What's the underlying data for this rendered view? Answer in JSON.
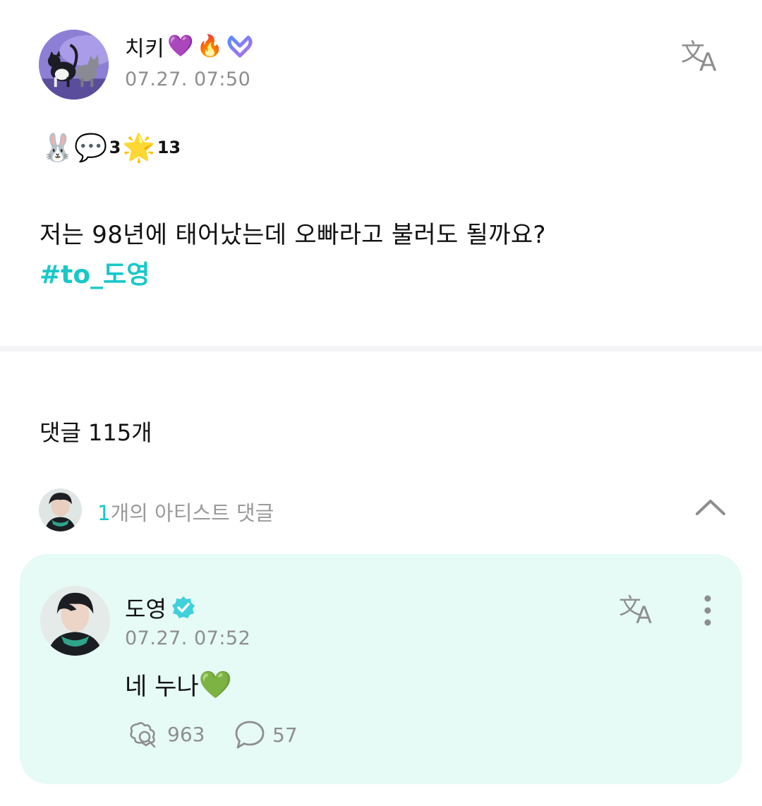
{
  "post": {
    "author": {
      "name": "치키",
      "badges": [
        "💜",
        "🔥"
      ],
      "membership_icon": "membership-badge-icon"
    },
    "timestamp": "07.27. 07:50",
    "emoji_line": {
      "first": "🐰",
      "second": "💬",
      "second_count": "3",
      "third": "🌟",
      "third_count": "13"
    },
    "text": "저는 98년에 태어났는데 오빠라고 불러도 될까요?",
    "hashtag": "#to_도영"
  },
  "comments": {
    "count_label": "댓글 115개",
    "artist_summary": {
      "count": "1",
      "label": "개의 아티스트 댓글"
    }
  },
  "artist_comment": {
    "name": "도영",
    "timestamp": "07.27. 07:52",
    "text": "네 누나",
    "emoji": "💚",
    "likes": "963",
    "replies": "57"
  },
  "colors": {
    "accent": "#18c8c8",
    "card_background": "#e6faf6",
    "muted_text": "#8e8e8e"
  }
}
